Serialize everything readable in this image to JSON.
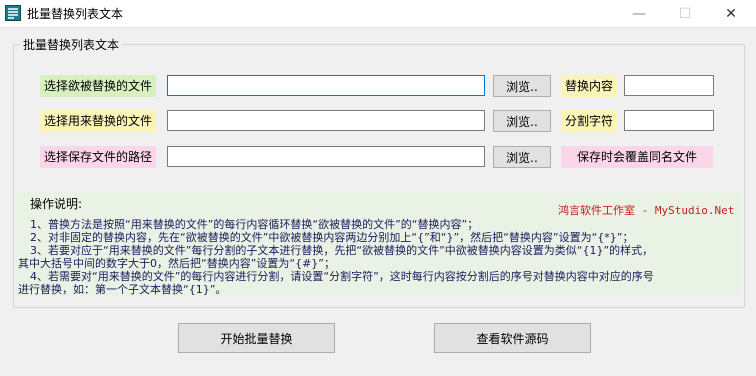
{
  "window": {
    "title": "批量替换列表文本",
    "minimize": "—",
    "maximize": "☐",
    "close": "✕"
  },
  "group": {
    "title": "批量替换列表文本"
  },
  "rows": {
    "source_label": "选择欲被替换的文件",
    "source_value": "",
    "source_browse": "浏览..",
    "replace_label": "选择用来替换的文件",
    "replace_value": "",
    "replace_browse": "浏览..",
    "save_label": "选择保存文件的路径",
    "save_value": "",
    "save_browse": "浏览..",
    "content_label": "替换内容",
    "content_value": "",
    "split_label": "分割字符",
    "split_value": "",
    "overwrite_note": "保存时会覆盖同名文件"
  },
  "instructions": {
    "title": "操作说明:",
    "brand": "鸿言软件工作室 - MyStudio.Net",
    "lines": [
      "1、普换方法是按照“用来替换的文件”的每行内容循环替换“欲被替换的文件”的“替换内容”；",
      "2、对非固定的替换内容，先在“欲被替换的文件”中欲被替换内容两边分别加上“{”和“}”，然后把“替换内容”设置为“{*}”；",
      "3、若要对应于“用来替换的文件”每行分割的子文本进行替换，先把“欲被替换的文件”中欲被替换内容设置为类似“{1}”的样式，",
      "其中大括号中间的数字大于0，然后把“替换内容”设置为“{#}”；",
      "4、若需要对“用来替换的文件”的每行内容进行分割，请设置“分割字符”，这时每行内容按分割后的序号对替换内容中对应的序号",
      "进行替换，如：第一个子文本替换“{1}”。"
    ]
  },
  "actions": {
    "start": "开始批量替换",
    "view_source": "查看软件源码"
  },
  "colors": {
    "label_green": "#d8f0c0",
    "label_yellow": "#fbf4b8",
    "label_pink": "#fbd6e8",
    "brand_red": "#c02020",
    "focus_blue": "#0078d7"
  }
}
